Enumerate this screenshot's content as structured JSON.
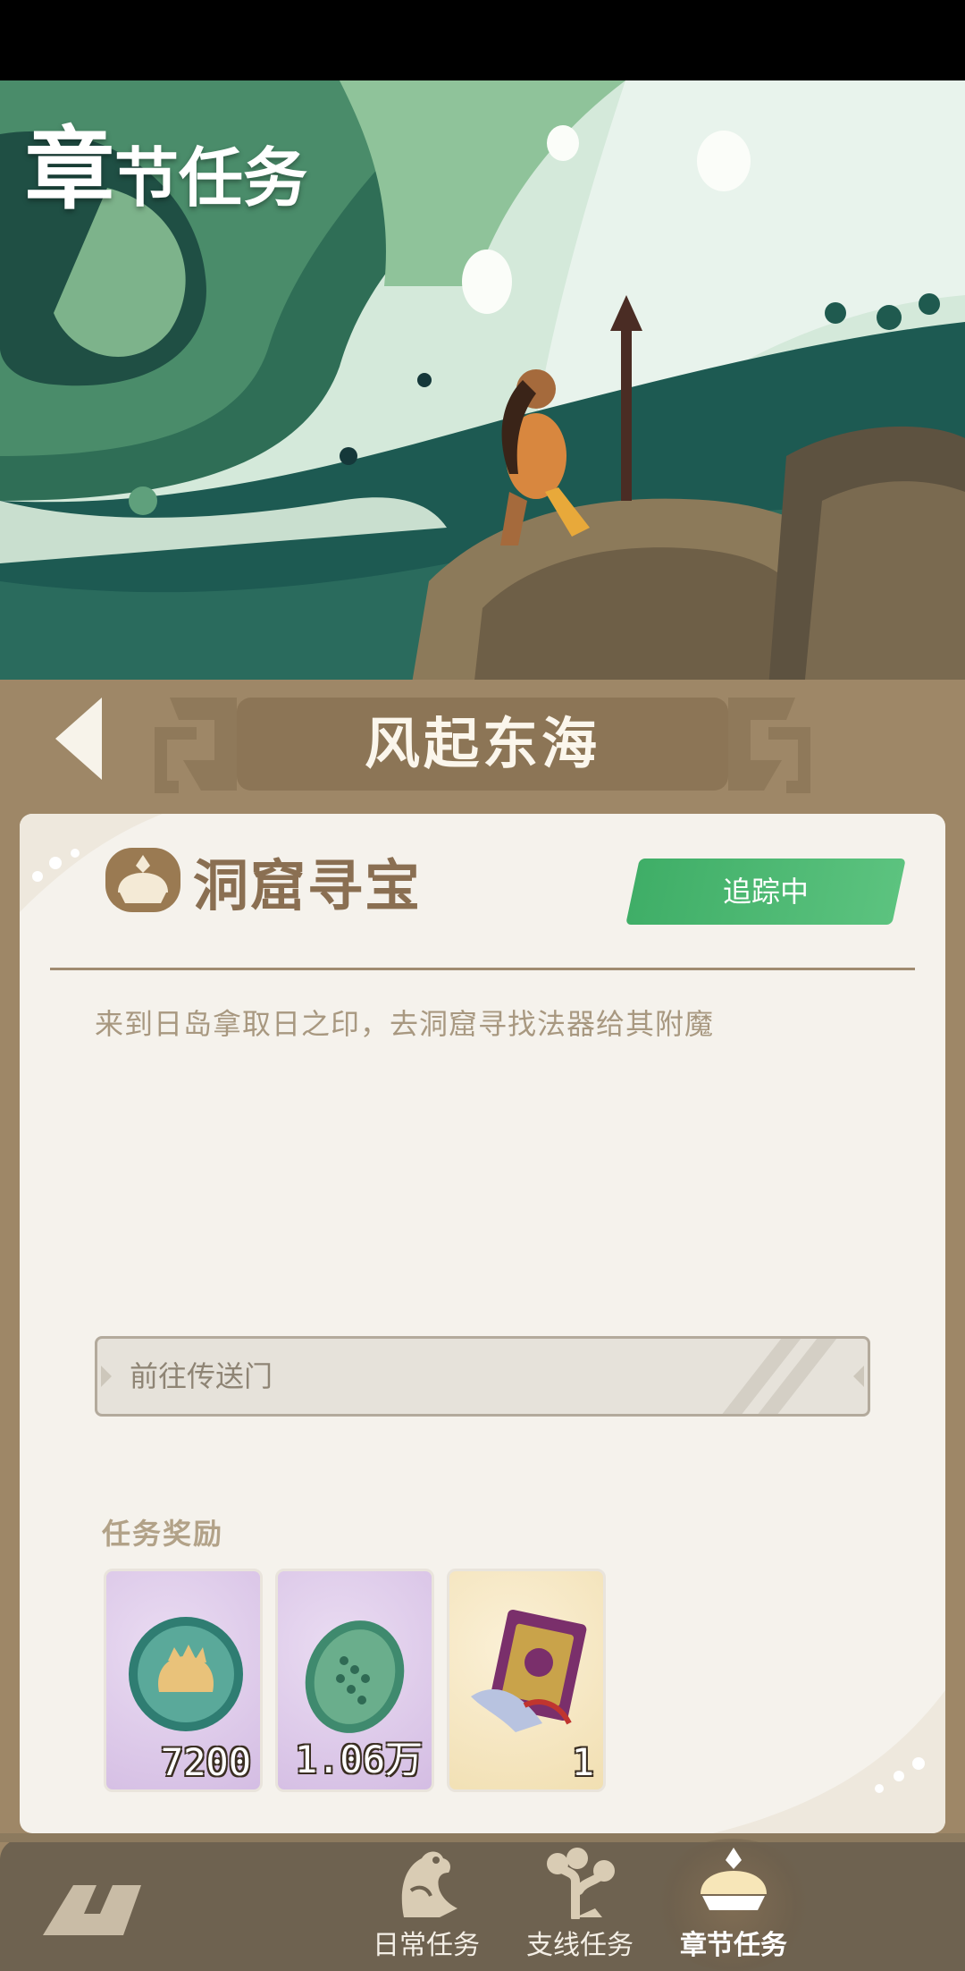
{
  "banner": {
    "title_big": "章",
    "title_rest": "节任务"
  },
  "chapter": {
    "title": "风起东海"
  },
  "task": {
    "title": "洞窟寻宝",
    "status_badge": "追踪中",
    "description": "来到日岛拿取日之印，去洞窟寻找法器给其附魔",
    "goto_button": "前往传送门"
  },
  "rewards": {
    "title": "任务奖励",
    "items": [
      {
        "icon": "jade-coin-icon",
        "count": "7200"
      },
      {
        "icon": "jade-token-icon",
        "count": "1.06万"
      },
      {
        "icon": "scroll-book-icon",
        "count": "1"
      }
    ]
  },
  "nav": {
    "items": [
      {
        "icon": "bird-icon",
        "label": "日常任务"
      },
      {
        "icon": "branch-icon",
        "label": "支线任务"
      },
      {
        "icon": "chapter-crown-icon",
        "label": "章节任务",
        "active": true
      }
    ]
  },
  "colors": {
    "frame_brown": "#9e8767",
    "card_bg": "#f5f2ec",
    "tracking_green": "#4cb872",
    "title_brown": "#8a6f52",
    "nav_bg": "#6e6250"
  }
}
